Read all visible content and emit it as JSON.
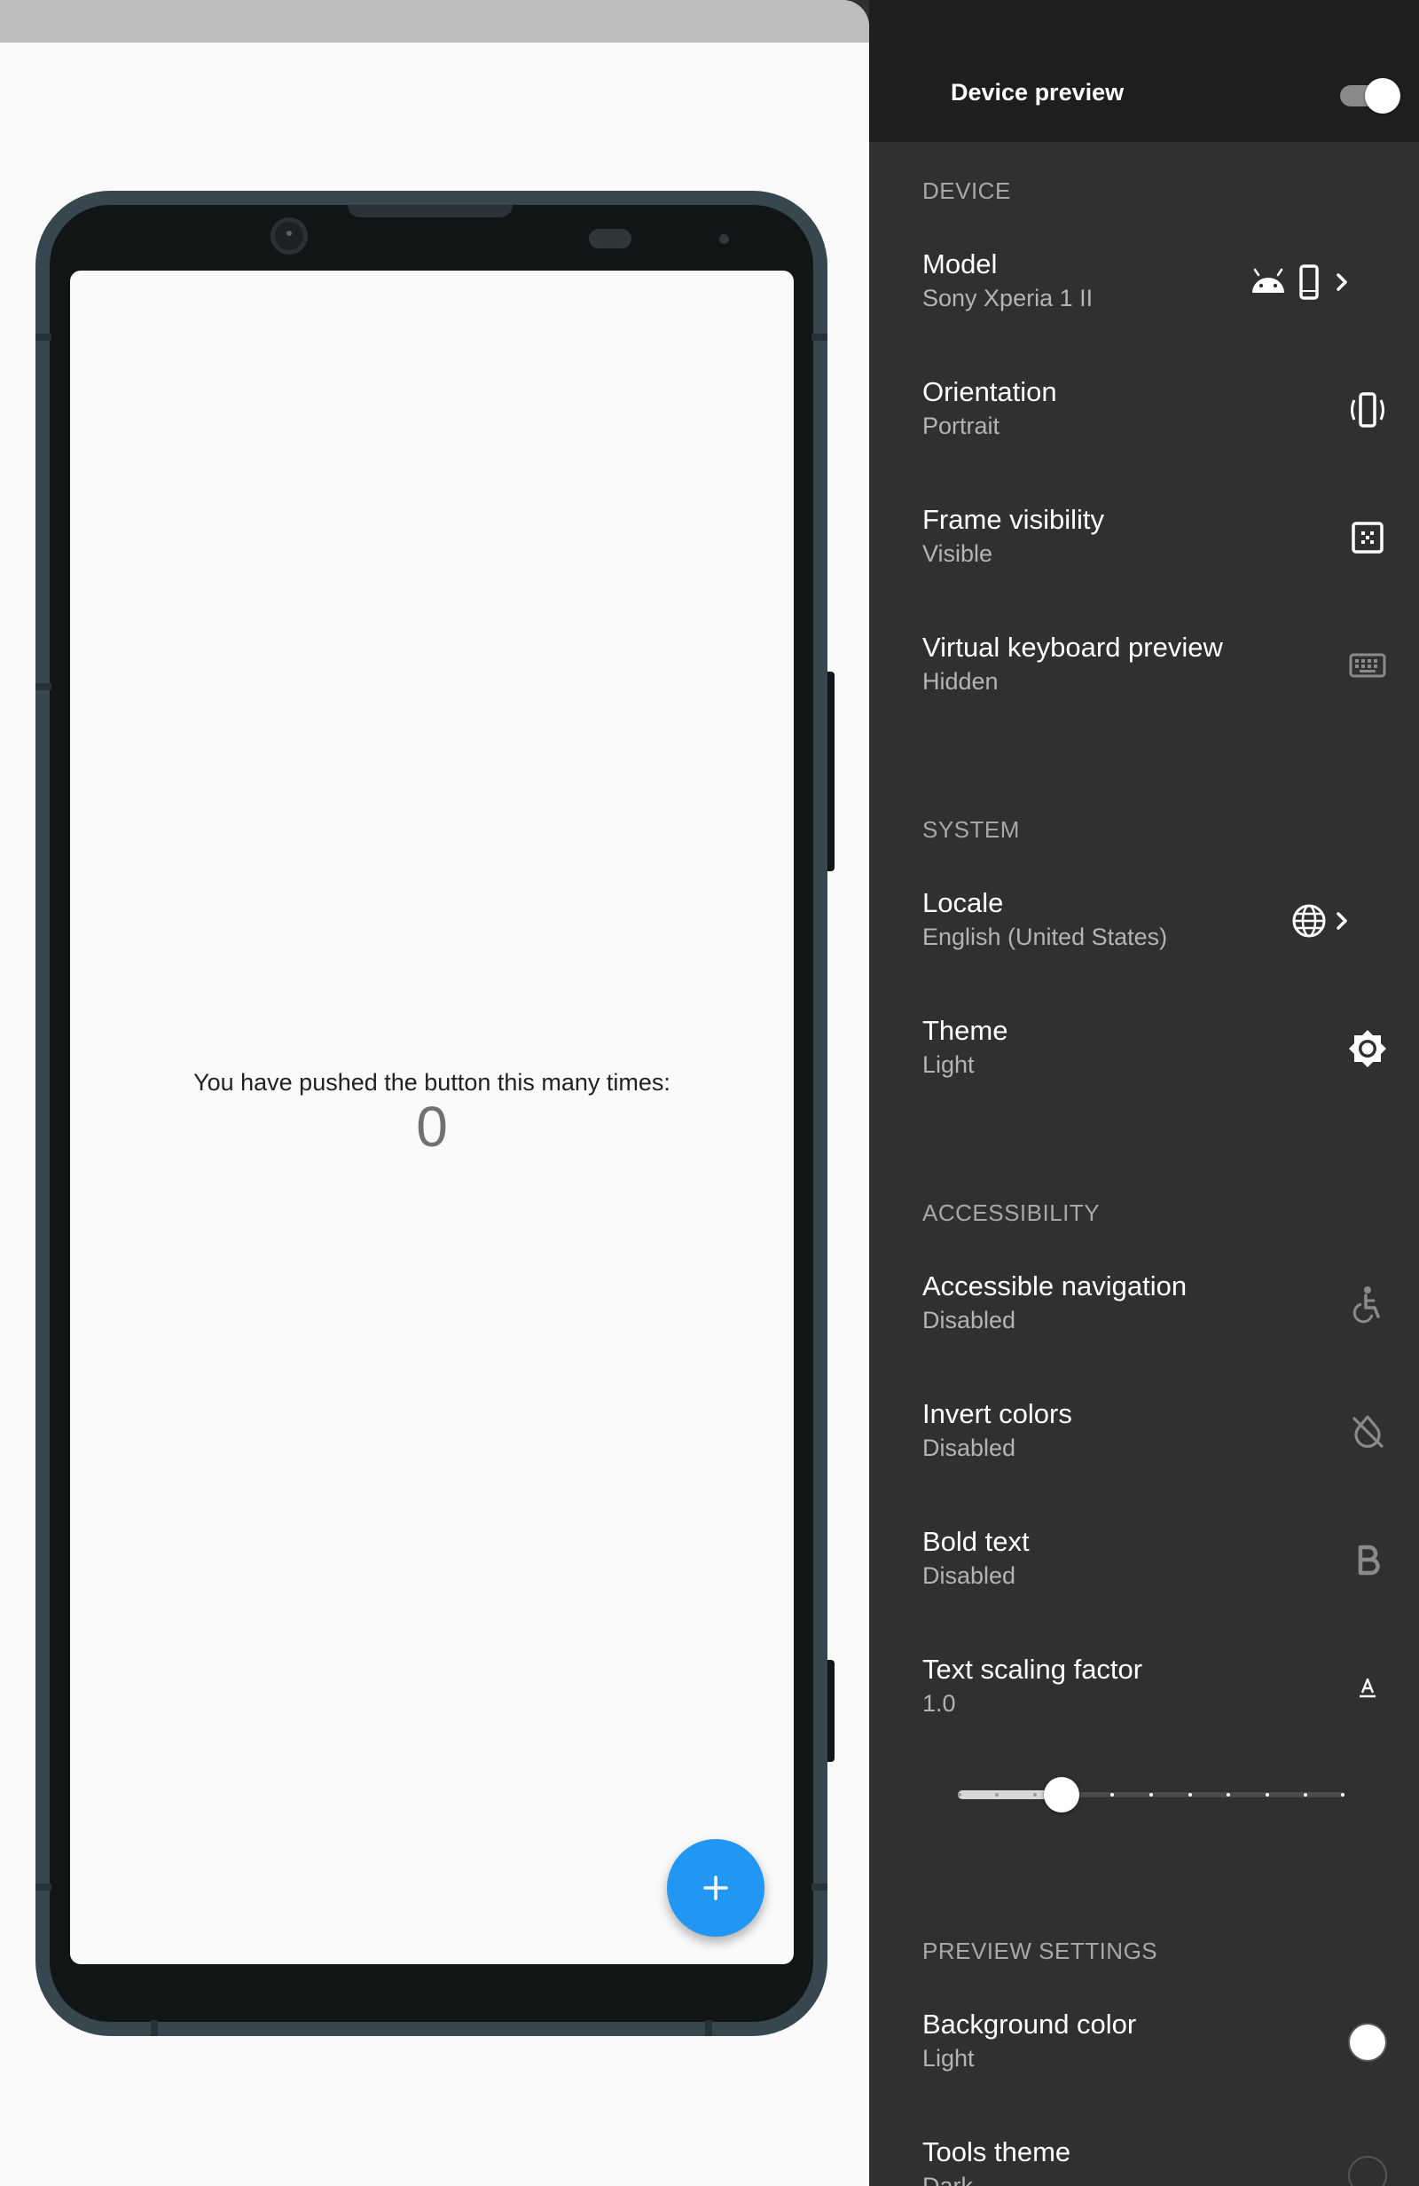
{
  "panel": {
    "title": "Device preview",
    "enabled": true
  },
  "app": {
    "counter_label": "You have pushed the button this many times:",
    "counter_value": "0",
    "fab_icon": "add-icon"
  },
  "device_section": {
    "title": "DEVICE",
    "model": {
      "title": "Model",
      "value": "Sony Xperia 1 II",
      "icons": [
        "android-icon",
        "smartphone-icon",
        "chevron-right-icon"
      ]
    },
    "orientation": {
      "title": "Orientation",
      "value": "Portrait",
      "icon": "screen-rotation-icon"
    },
    "frame_visibility": {
      "title": "Frame visibility",
      "value": "Visible",
      "icon": "frame-icon"
    },
    "virtual_keyboard": {
      "title": "Virtual keyboard preview",
      "value": "Hidden",
      "icon": "keyboard-icon"
    }
  },
  "system_section": {
    "title": "SYSTEM",
    "locale": {
      "title": "Locale",
      "value": "English (United States)",
      "icons": [
        "globe-icon",
        "chevron-right-icon"
      ]
    },
    "theme": {
      "title": "Theme",
      "value": "Light",
      "icon": "brightness-icon"
    }
  },
  "accessibility_section": {
    "title": "ACCESSIBILITY",
    "accessible_navigation": {
      "title": "Accessible navigation",
      "value": "Disabled",
      "icon": "accessible-icon"
    },
    "invert_colors": {
      "title": "Invert colors",
      "value": "Disabled",
      "icon": "invert-colors-off-icon"
    },
    "bold_text": {
      "title": "Bold text",
      "value": "Disabled",
      "icon": "bold-icon"
    },
    "text_scaling": {
      "title": "Text scaling factor",
      "value": "1.0",
      "icon": "text-format-icon",
      "slider_position": 0.25,
      "slider_steps": 11
    }
  },
  "preview_settings_section": {
    "title": "PREVIEW SETTINGS",
    "background_color": {
      "title": "Background color",
      "value": "Light",
      "icon": "color-circle-icon"
    },
    "tools_theme": {
      "title": "Tools theme",
      "value": "Dark",
      "icon": "color-circle-icon"
    }
  },
  "colors": {
    "panel_bg": "#303030",
    "header_bg": "#1e1e1e",
    "fab": "#2196f3",
    "phone_frame": "#37474f",
    "screen_bg": "#fafafa"
  }
}
